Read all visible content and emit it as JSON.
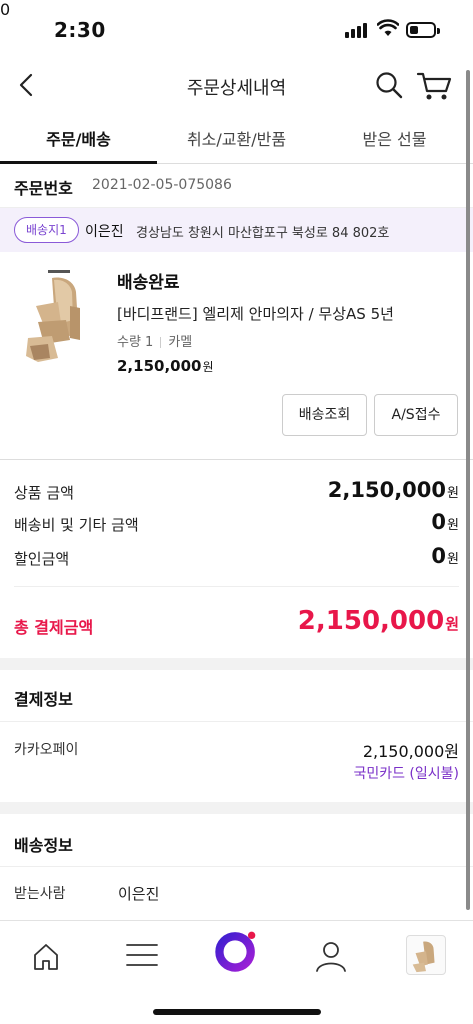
{
  "status_bar": {
    "time": "2:30",
    "battery_level": 0.35
  },
  "header": {
    "title": "주문상세내역",
    "cart_count": "0"
  },
  "tabs": [
    {
      "label": "주문/배송",
      "active": true
    },
    {
      "label": "취소/교환/반품",
      "active": false
    },
    {
      "label": "받은 선물",
      "active": false
    }
  ],
  "order": {
    "label": "주문번호",
    "number": "2021-02-05-075086"
  },
  "address": {
    "chip": "배송지1",
    "name": "이은진",
    "line": "경상남도 창원시 마산합포구 북성로 84 802호"
  },
  "product": {
    "status": "배송완료",
    "name": "[바디프랜드] 엘리제 안마의자 / 무상AS 5년",
    "quantity": "수량 1",
    "option": "카멜",
    "price": "2,150,000",
    "won": "원",
    "buttons": {
      "track": "배송조회",
      "as": "A/S접수"
    }
  },
  "summary": {
    "rows": [
      {
        "label": "상품 금액",
        "value": "2,150,000",
        "won": "원"
      },
      {
        "label": "배송비 및 기타 금액",
        "value": "0",
        "won": "원"
      },
      {
        "label": "할인금액",
        "value": "0",
        "won": "원"
      }
    ],
    "total": {
      "label": "총 결제금액",
      "value": "2,150,000",
      "won": "원"
    }
  },
  "payment": {
    "title": "결제정보",
    "method": "카카오페이",
    "amount": "2,150,000원",
    "card": "국민카드 (일시불)"
  },
  "shipping": {
    "title": "배송정보",
    "recipient_label": "받는사람",
    "recipient": "이은진"
  },
  "colors": {
    "accent_purple": "#6a2bd6",
    "total_red": "#e8174a",
    "card_purple": "#7a30c8",
    "address_bg": "#f4f0fb"
  },
  "bottom_nav": [
    {
      "icon": "home-icon"
    },
    {
      "icon": "menu-icon"
    },
    {
      "icon": "brand-logo-icon"
    },
    {
      "icon": "person-icon"
    },
    {
      "icon": "recent-product-thumbnail"
    }
  ]
}
